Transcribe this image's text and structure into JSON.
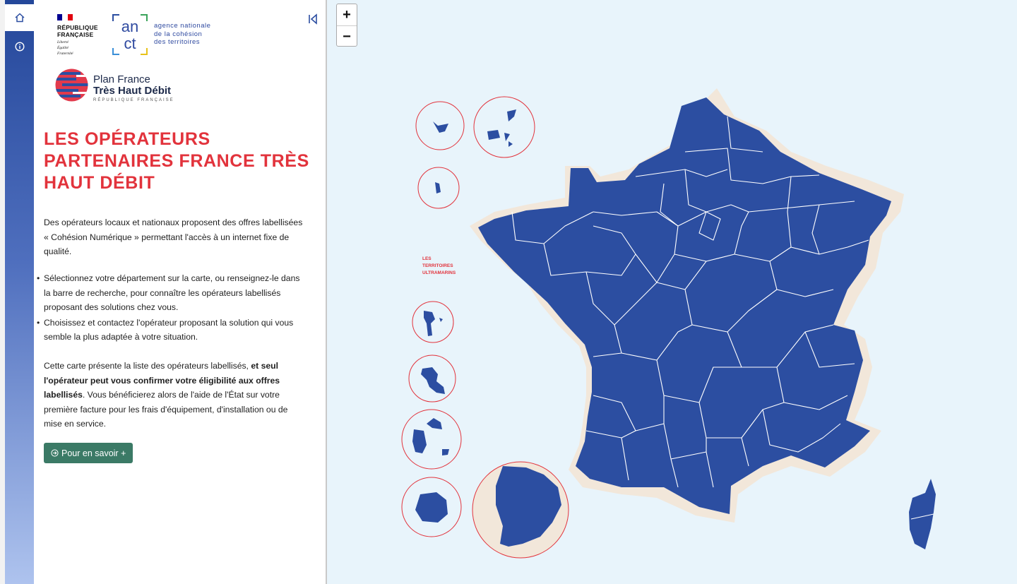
{
  "sidebar": {
    "nav": [
      {
        "icon": "home-icon",
        "active": true
      },
      {
        "icon": "info-icon",
        "active": false
      }
    ]
  },
  "panel": {
    "logos": {
      "rf_name": "RÉPUBLIQUE\nFRANÇAISE",
      "rf_motto": "Liberté\nÉgalité\nFraternité",
      "anct_letters_top": "an",
      "anct_letters_bottom": "ct",
      "anct_text": "agence nationale\nde la cohésion\ndes territoires",
      "thd_line1": "Plan France",
      "thd_line2": "Très Haut Débit",
      "thd_line3": "RÉPUBLIQUE FRANÇAISE"
    },
    "title": "Les opérateurs partenaires France Très Haut Débit",
    "intro": "Des opérateurs locaux et nationaux proposent des offres labellisées « Cohésion Numérique » permettant l'accès à un internet fixe de qualité.",
    "bullets": [
      "Sélectionnez votre département sur la carte, ou renseignez-le dans la barre de recherche, pour connaître les opérateurs labellisés proposant des solutions chez vous.",
      "Choisissez et contactez l'opérateur proposant la solution qui vous semble la plus adaptée à votre situation."
    ],
    "outro_before": "Cette carte présente la liste des opérateurs labellisés, ",
    "outro_bold": "et seul l'opérateur peut vous confirmer votre éligibilité aux offres labellisés",
    "outro_after": ". Vous bénéficierez alors de l'aide de l'État sur votre première facture pour les frais d'équipement, d'installation ou de mise en service.",
    "cta_label": "Pour en savoir +"
  },
  "map": {
    "zoom_in": "+",
    "zoom_out": "−",
    "outremer_label": "LES\nTERRITOIRES\nULTRAMARINS",
    "colors": {
      "departement": "#2c4ea1",
      "border": "#ffffff",
      "sea": "#e8f4fb",
      "coast": "#f2e7da",
      "circle": "#e2333c",
      "accent_red": "#e2333c",
      "cta_green": "#3b7a66"
    }
  }
}
